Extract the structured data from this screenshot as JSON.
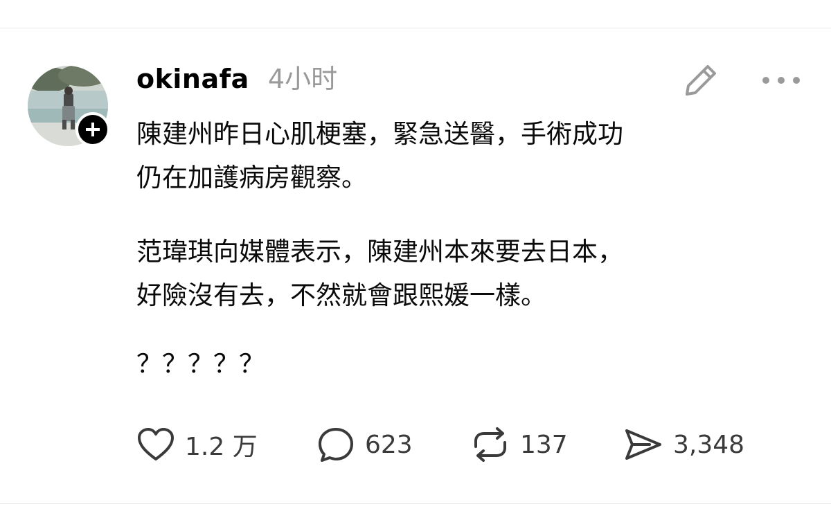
{
  "post": {
    "username": "okinafa",
    "timestamp": "4小时",
    "paragraphs": [
      [
        "陳建州昨日心肌梗塞，緊急送醫，手術成功",
        "仍在加護病房觀察。"
      ],
      [
        "范瑋琪向媒體表示，陳建州本來要去日本，",
        "好險沒有去，不然就會跟熙媛一樣。"
      ],
      [
        "？？？？？"
      ]
    ]
  },
  "actions": {
    "like_count": "1.2 万",
    "reply_count": "623",
    "repost_count": "137",
    "share_count": "3,348"
  },
  "icons": {
    "avatar": "profile-photo",
    "follow": "plus-icon",
    "edit": "pencil-icon",
    "more": "more-dots-icon",
    "like": "heart-icon",
    "reply": "speech-bubble-icon",
    "repost": "repost-icon",
    "share": "send-icon"
  },
  "colors": {
    "text": "#0a0a0a",
    "muted": "#9a9a9a",
    "icon": "#3a3a3a",
    "badge": "#000000"
  }
}
